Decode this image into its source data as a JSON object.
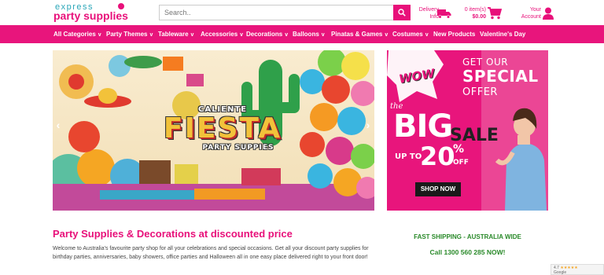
{
  "logo": {
    "top": "express",
    "bottom": "party supplies"
  },
  "search": {
    "placeholder": "Search.."
  },
  "delivery": {
    "line1": "Delivery",
    "line2": "Info"
  },
  "cart": {
    "items": "0 item(s)",
    "total": "$0.00"
  },
  "account": {
    "line1": "Your",
    "line2": "Account"
  },
  "nav": [
    {
      "label": "All Categories",
      "chevron": "v"
    },
    {
      "label": "Party Themes",
      "chevron": "v"
    },
    {
      "label": "Tableware",
      "chevron": "v"
    },
    {
      "label": "Accessories",
      "chevron": "v"
    },
    {
      "label": "Decorations",
      "chevron": "v"
    },
    {
      "label": "Balloons",
      "chevron": "v"
    },
    {
      "label": "Pinatas & Games",
      "chevron": "v"
    },
    {
      "label": "Costumes",
      "chevron": "v"
    },
    {
      "label": "New Products",
      "chevron": ""
    },
    {
      "label": "Valentine's Day",
      "chevron": ""
    }
  ],
  "hero": {
    "line1": "CALIENTE",
    "line2": "FIESTA",
    "line3": "PARTY SUPPIES"
  },
  "promo": {
    "wow": "WOW",
    "line1": "GET OUR",
    "line2": "SPECIAL",
    "line3": "OFFER",
    "the": "the",
    "big": "BIG",
    "sale": "SALE",
    "upto": "UP TO",
    "percent": "20",
    "pct_sign": "%",
    "off": "OFF",
    "button": "SHOP NOW"
  },
  "main": {
    "title": "Party Supplies & Decorations at discounted price",
    "intro": "Welcome to Australia's favourite party shop for all your celebrations and special occasions. Get all your discount party supplies for birthday parties, anniversaries, baby showers, office parties and Halloween all in one easy place delivered right to your front door!"
  },
  "side": {
    "shipping": "FAST SHIPPING - AUSTRALIA WIDE",
    "call": "Call 1300 560 285 NOW!"
  },
  "rating": {
    "score": "4.7",
    "stars": "★★★★★",
    "source": "Google"
  },
  "arrows": {
    "prev": "‹",
    "next": "›"
  },
  "colors": {
    "brand": "#e8157c",
    "teal": "#2aa6b8",
    "green": "#2a8a2a"
  }
}
